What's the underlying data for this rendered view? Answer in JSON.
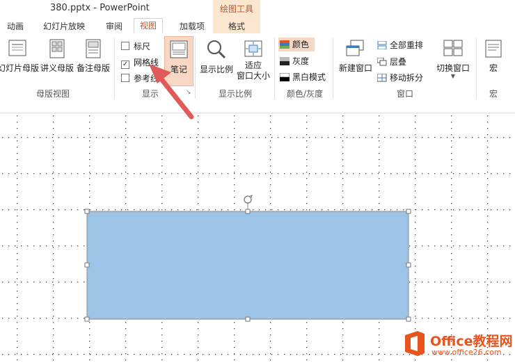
{
  "window": {
    "title": "380.pptx - PowerPoint"
  },
  "context_tab": {
    "title": "绘图工具",
    "tab": "格式"
  },
  "tabs": [
    "动画",
    "幻灯片放映",
    "审阅",
    "视图",
    "加载项"
  ],
  "ribbon": {
    "master_views": {
      "items": [
        "幻灯片母版",
        "讲义母版",
        "备注母版"
      ],
      "label": "母版视图"
    },
    "show": {
      "ruler": "标尺",
      "gridlines": "网格线",
      "guides": "参考线",
      "notes": "笔记",
      "label": "显示"
    },
    "zoom": {
      "zoom": "显示比例",
      "fit_line1": "适应",
      "fit_line2": "窗口大小",
      "label": "显示比例"
    },
    "color": {
      "color": "颜色",
      "grayscale": "灰度",
      "bw": "黑白模式",
      "label": "颜色/灰度"
    },
    "window": {
      "new_window": "新建窗口",
      "arrange_all": "全部重排",
      "cascade": "层叠",
      "move_split": "移动拆分",
      "switch": "切换窗口",
      "label": "窗口"
    },
    "macros": {
      "macro": "宏",
      "label": "宏"
    }
  },
  "watermark": {
    "name": "Office教程网",
    "url": "www.office26.com"
  },
  "colors": {
    "accent": "#c0522a",
    "shape_fill": "#9dc3e6",
    "arrow": "#e05a5a",
    "highlight": "#f8d7c4"
  }
}
